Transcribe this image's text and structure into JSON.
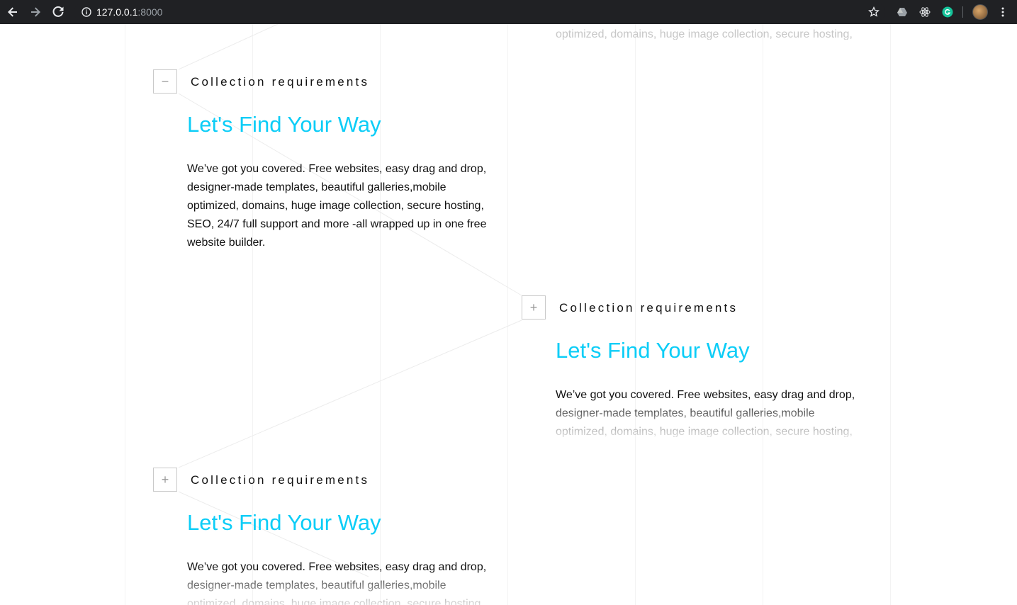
{
  "browser": {
    "url_host": "127.0.0.1",
    "url_port": ":8000",
    "icons": [
      "back-arrow-icon",
      "forward-arrow-icon",
      "reload-icon",
      "info-icon",
      "star-icon",
      "drive-icon",
      "react-icon",
      "grammarly-icon",
      "avatar",
      "menu-dots-icon"
    ]
  },
  "sections": [
    {
      "toggle": "−",
      "label": "Collection requirements",
      "heading": "Let's Find Your Way",
      "body": "We’ve got you covered. Free websites, easy drag and drop, designer-made templates, beautiful galleries,mobile optimized, domains, huge image collection, secure hosting, SEO, 24/7 full support and more -all wrapped up in one free website builder."
    },
    {
      "toggle": "+",
      "label": "Collection requirements",
      "heading": "Let's Find Your Way",
      "body": "We’ve got you covered. Free websites, easy drag and drop, designer-made templates, beautiful galleries,mobile optimized, domains, huge image collection, secure hosting,"
    },
    {
      "toggle": "+",
      "label": "Collection requirements",
      "heading": "Let's Find Your Way",
      "body": "We’ve got you covered. Free websites, easy drag and drop, designer-made templates, beautiful galleries,mobile optimized, domains, huge image collection, secure hosting,"
    }
  ],
  "top_cut_text": "optimized, domains, huge image collection, secure hosting,",
  "colors": {
    "heading": "#0ccdf7",
    "text": "#111111",
    "toggle_border": "#c9c9c9",
    "browser_bg": "#202124"
  }
}
